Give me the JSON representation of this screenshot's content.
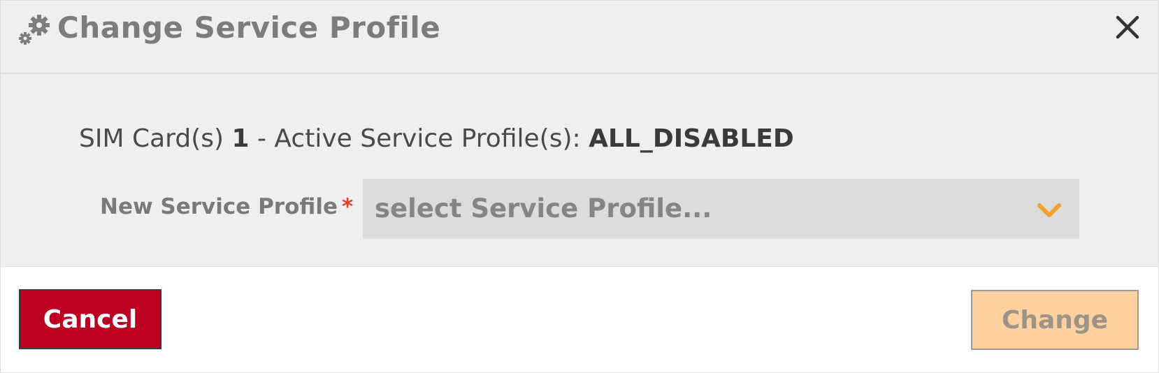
{
  "dialog": {
    "title": "Change Service Profile",
    "title_icon": "gears-icon",
    "close_icon": "close-icon"
  },
  "summary": {
    "prefix": "SIM Card(s) ",
    "count": "1",
    "middle": " - Active Service Profile(s): ",
    "active_profile": "ALL_DISABLED"
  },
  "form": {
    "new_profile_label": "New Service Profile",
    "required_marker": "*",
    "select_placeholder": "select Service Profile...",
    "select_icon": "chevron-down-icon"
  },
  "footer": {
    "cancel_label": "Cancel",
    "change_label": "Change"
  },
  "colors": {
    "cancel_bg": "#bb0022",
    "change_bg_disabled": "#ffd19f",
    "accent_chevron": "#f5a030",
    "required": "#e0402a"
  }
}
